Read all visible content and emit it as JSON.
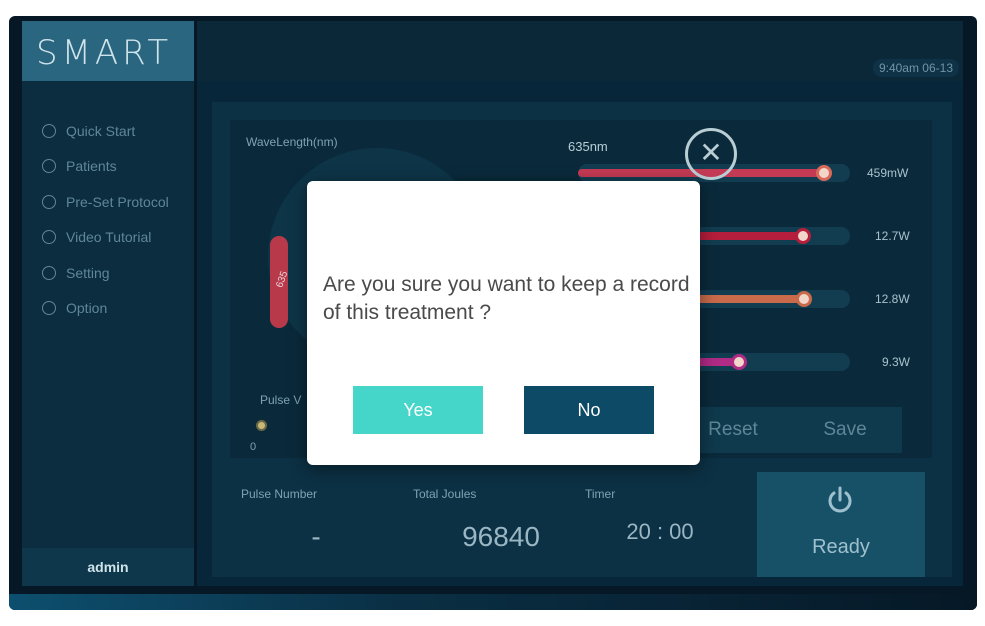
{
  "app": {
    "logo": "SMART"
  },
  "clock": "9:40am 06-13",
  "sidebar": {
    "items": [
      {
        "label": "Quick Start",
        "icon": "quick-start-icon"
      },
      {
        "label": "Patients",
        "icon": "patients-icon"
      },
      {
        "label": "Pre-Set Protocol",
        "icon": "layers-icon"
      },
      {
        "label": "Video Tutorial",
        "icon": "play-icon"
      },
      {
        "label": "Setting",
        "icon": "gear-icon"
      },
      {
        "label": "Option",
        "icon": "minus-circle-icon"
      }
    ],
    "user": "admin"
  },
  "panel": {
    "wavelength_label": "WaveLength(nm)",
    "gauge_value": "635",
    "pulse_label": "Pulse V",
    "pulse_min": "0",
    "wavelength_top": "635nm",
    "sliders": [
      {
        "value": "459mW",
        "color": "#c43a54",
        "level": 0.88
      },
      {
        "value": "12.7W",
        "color": "#b51e3c",
        "level": 0.78
      },
      {
        "value": "12.8W",
        "color": "#c96a4a",
        "level": 0.78
      },
      {
        "value": "9.3W",
        "color": "#b02b86",
        "level": 0.55
      }
    ],
    "reset_label": "Reset",
    "save_label": "Save"
  },
  "stats": {
    "pulse_number_label": "Pulse Number",
    "pulse_number_value": "-",
    "total_joules_label": "Total Joules",
    "total_joules_value": "96840",
    "timer_label": "Timer",
    "timer_value": "20 : 00",
    "ready_label": "Ready"
  },
  "dialog": {
    "message": "Are you sure you want to keep a record of this treatment ?",
    "yes_label": "Yes",
    "no_label": "No",
    "yes_color": "#45d6c9",
    "no_color": "#0d4a66"
  }
}
